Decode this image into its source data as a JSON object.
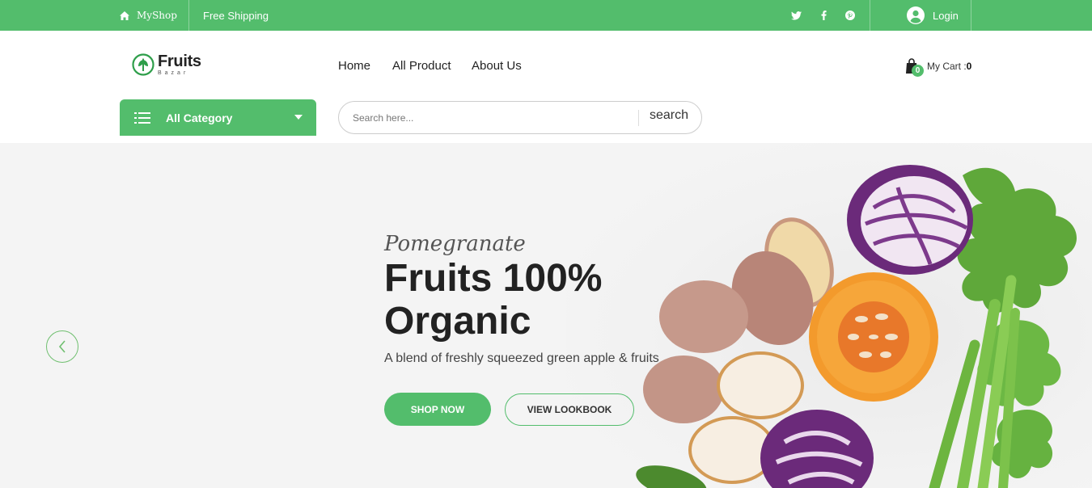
{
  "topbar": {
    "shop_name": "MyShop",
    "shipping_text": "Free Shipping",
    "login_label": "Login",
    "social_icons": [
      "twitter-icon",
      "facebook-icon",
      "pinterest-icon"
    ],
    "color": "#53bd6c"
  },
  "logo": {
    "name": "Fruits",
    "sub": "Bazar"
  },
  "nav": {
    "items": [
      "Home",
      "All Product",
      "About Us"
    ]
  },
  "cart": {
    "label": "My Cart :",
    "count": "0",
    "badge": "0"
  },
  "category": {
    "label": "All Category"
  },
  "search": {
    "placeholder": "Search here...",
    "button_label": "search"
  },
  "hero": {
    "subtitle": "Pomegranate",
    "title_line1": "Fruits 100%",
    "title_line2": "Organic",
    "description": "A blend of freshly squeezed green apple & fruits",
    "shop_button": "SHOP NOW",
    "lookbook_button": "VIEW LOOKBOOK"
  },
  "colors": {
    "accent": "#53bd6c",
    "text": "#222222"
  }
}
